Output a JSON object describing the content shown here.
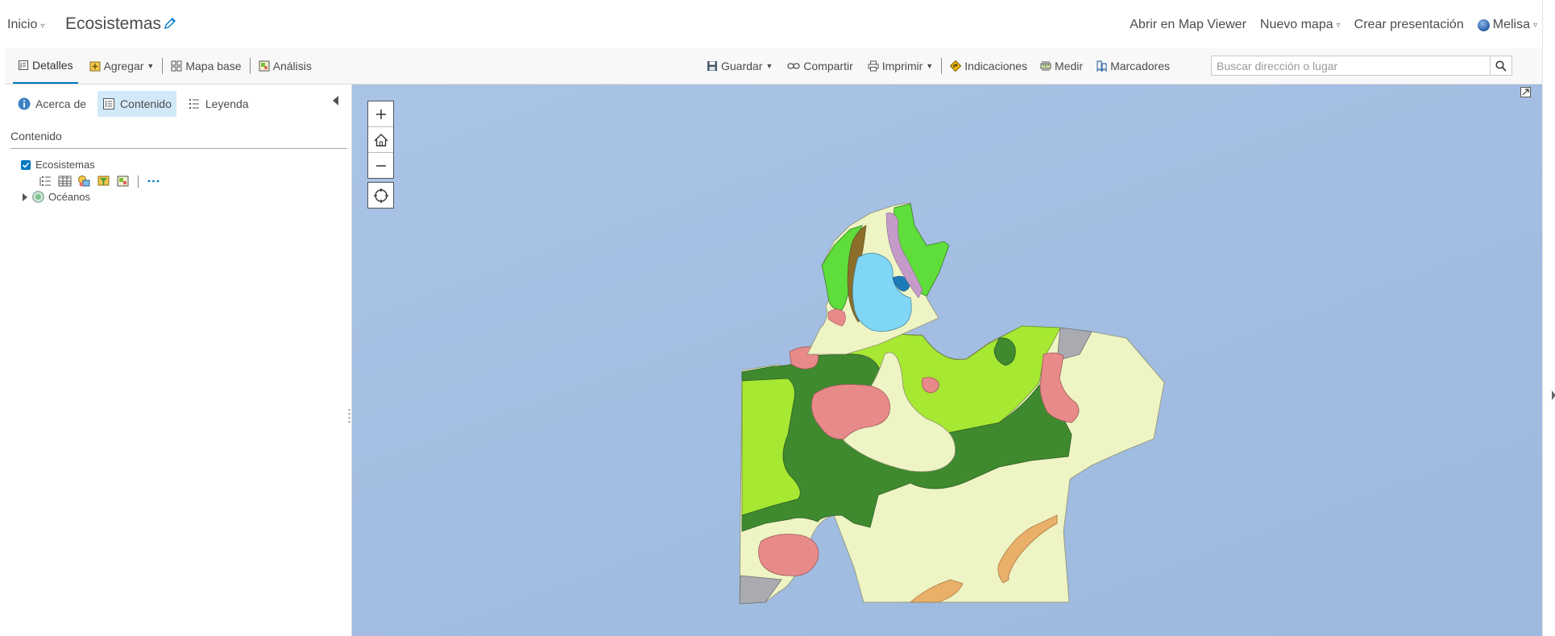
{
  "header": {
    "home_label": "Inicio",
    "map_title": "Ecosistemas",
    "nav": {
      "open_map_viewer": "Abrir en Map Viewer",
      "new_map": "Nuevo mapa",
      "create_presentation": "Crear presentación",
      "user": "Melisa"
    }
  },
  "toolbar": {
    "details": "Detalles",
    "add": "Agregar",
    "basemap": "Mapa base",
    "analysis": "Análisis",
    "save": "Guardar",
    "share": "Compartir",
    "print": "Imprimir",
    "directions": "Indicaciones",
    "measure": "Medir",
    "bookmarks": "Marcadores",
    "search_placeholder": "Buscar dirección o lugar"
  },
  "panel": {
    "tabs": {
      "about": "Acerca de",
      "content": "Contenido",
      "legend": "Leyenda"
    },
    "section_title": "Contenido",
    "layers": [
      {
        "name": "Ecosistemas",
        "checked": true
      },
      {
        "name": "Océanos",
        "checked": false
      }
    ]
  },
  "map": {
    "zoom_in": "+",
    "zoom_out": "−"
  },
  "colors": {
    "accent": "#0079c1",
    "active_tab_bg": "#d2e9f9",
    "ocean": "#a5c0e3",
    "pale_yellow_green": "#eef4c4",
    "bright_green": "#a6e832",
    "dark_green": "#3f8a2e",
    "salmon": "#e8898a",
    "orange": "#eab06a",
    "lake_blue": "#7fd7f5",
    "grey": "#a9abb0",
    "vivid_green": "#5fdd3a"
  }
}
